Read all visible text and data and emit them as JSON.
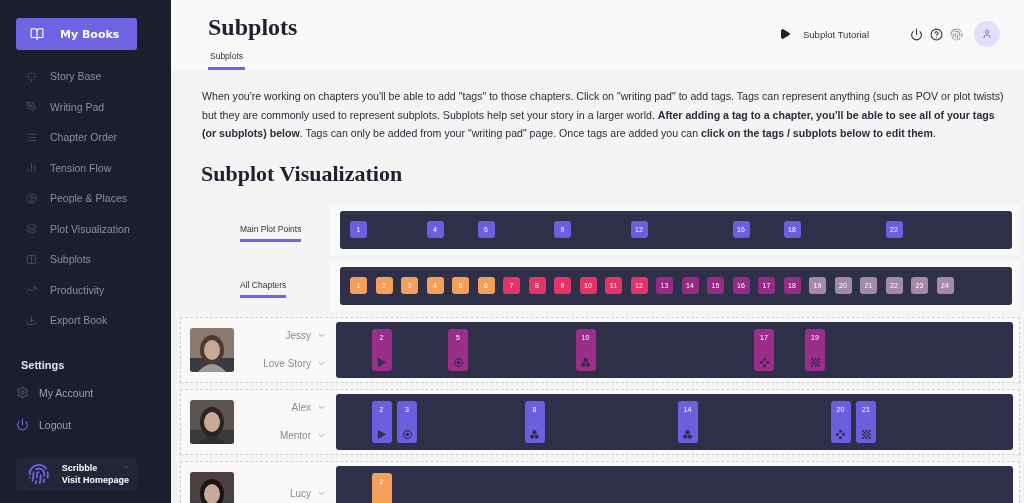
{
  "sidebar": {
    "primary_button": "My Books",
    "items": [
      {
        "label": "Story Base"
      },
      {
        "label": "Writing Pad"
      },
      {
        "label": "Chapter Order"
      },
      {
        "label": "Tension Flow"
      },
      {
        "label": "People & Places"
      },
      {
        "label": "Plot Visualization"
      },
      {
        "label": "Subplots"
      },
      {
        "label": "Productivity"
      },
      {
        "label": "Export Book"
      }
    ],
    "settings_heading": "Settings",
    "settings_items": [
      {
        "label": "My Account"
      },
      {
        "label": "Logout"
      }
    ],
    "footer": {
      "title": "Scribble",
      "link": "Visit Homepage"
    }
  },
  "header": {
    "title": "Subplots",
    "tabs": [
      {
        "label": "Subplots",
        "selected": true
      }
    ],
    "tutorial": "Subplot Tutorial"
  },
  "intro": "When you're working on chapters you'll be able to add \"tags\" to those chapters. Click on \"writing pad\" to add tags.  Tags can represent anything (such as POV or plot twists) but they are commonly used to represent subplots. Subplots help set your story in a larger world. **After adding a tag to a chapter, you'll be able to see all of your tags (or subplots) below**. Tags can only be added from your \"writing pad\" page. Once tags are added you can **click on the tags / subplots below to edit them**.",
  "visualization": {
    "heading": "Subplot Visualization",
    "main_plot_points": {
      "label": "Main Plot Points",
      "slots": [
        {
          "kind": "point",
          "label": "1"
        },
        {
          "kind": "gap"
        },
        {
          "kind": "gap"
        },
        {
          "kind": "point",
          "label": "4"
        },
        {
          "kind": "gap"
        },
        {
          "kind": "point",
          "label": "6"
        },
        {
          "kind": "gap"
        },
        {
          "kind": "gap"
        },
        {
          "kind": "point",
          "label": "9"
        },
        {
          "kind": "gap"
        },
        {
          "kind": "gap"
        },
        {
          "kind": "point",
          "label": "12"
        },
        {
          "kind": "gap"
        },
        {
          "kind": "gap"
        },
        {
          "kind": "gap"
        },
        {
          "kind": "point",
          "label": "16"
        },
        {
          "kind": "gap"
        },
        {
          "kind": "point",
          "label": "18"
        },
        {
          "kind": "gap"
        },
        {
          "kind": "gap"
        },
        {
          "kind": "gap"
        },
        {
          "kind": "point",
          "label": "22"
        }
      ]
    },
    "all_chapters": {
      "label": "All Chapters",
      "chapters": [
        {
          "label": "1",
          "color": "#f5a05a"
        },
        {
          "label": "2",
          "color": "#f5a05a"
        },
        {
          "label": "3",
          "color": "#f5a05a"
        },
        {
          "label": "4",
          "color": "#f5a05a"
        },
        {
          "label": "5",
          "color": "#f5a05a"
        },
        {
          "label": "6",
          "color": "#f5a05a"
        },
        {
          "label": "7",
          "color": "#e23566"
        },
        {
          "label": "8",
          "color": "#e23566"
        },
        {
          "label": "9",
          "color": "#e23566"
        },
        {
          "label": "10",
          "color": "#e23566"
        },
        {
          "label": "11",
          "color": "#e23566"
        },
        {
          "label": "12",
          "color": "#e23566"
        },
        {
          "label": "13",
          "color": "#932c82"
        },
        {
          "label": "14",
          "color": "#932c82"
        },
        {
          "label": "15",
          "color": "#932c82"
        },
        {
          "label": "16",
          "color": "#932c82"
        },
        {
          "label": "17",
          "color": "#932c82"
        },
        {
          "label": "18",
          "color": "#932c82"
        },
        {
          "label": "19",
          "color": "#a38aa8"
        },
        {
          "label": "20",
          "color": "#a38aa8"
        },
        {
          "label": "21",
          "color": "#a38aa8"
        },
        {
          "label": "22",
          "color": "#a38aa8"
        },
        {
          "label": "23",
          "color": "#a38aa8"
        },
        {
          "label": "24",
          "color": "#a38aa8"
        }
      ]
    },
    "subplots": [
      {
        "character": "Jessy",
        "subplot": "Love Story",
        "color": "#9b2e88",
        "tags": [
          {
            "kind": "gap"
          },
          {
            "label": "2",
            "kind": "play"
          },
          {
            "kind": "gap"
          },
          {
            "kind": "gap"
          },
          {
            "label": "5",
            "kind": "target"
          },
          {
            "kind": "gap"
          },
          {
            "kind": "gap"
          },
          {
            "kind": "gap"
          },
          {
            "kind": "gap"
          },
          {
            "label": "10",
            "kind": "trefoil"
          },
          {
            "kind": "gap"
          },
          {
            "kind": "gap"
          },
          {
            "kind": "gap"
          },
          {
            "kind": "gap"
          },
          {
            "kind": "gap"
          },
          {
            "kind": "gap"
          },
          {
            "label": "17",
            "kind": "diamond"
          },
          {
            "kind": "gap"
          },
          {
            "label": "19",
            "kind": "checker"
          }
        ]
      },
      {
        "character": "Alex",
        "subplot": "Mentor",
        "color": "#6b5fe0",
        "tags": [
          {
            "kind": "gap"
          },
          {
            "label": "2",
            "kind": "play"
          },
          {
            "label": "3",
            "kind": "target"
          },
          {
            "kind": "gap"
          },
          {
            "kind": "gap"
          },
          {
            "kind": "gap"
          },
          {
            "kind": "gap"
          },
          {
            "label": "8",
            "kind": "trefoil"
          },
          {
            "kind": "gap"
          },
          {
            "kind": "gap"
          },
          {
            "kind": "gap"
          },
          {
            "kind": "gap"
          },
          {
            "kind": "gap"
          },
          {
            "label": "14",
            "kind": "trefoil"
          },
          {
            "kind": "gap"
          },
          {
            "kind": "gap"
          },
          {
            "kind": "gap"
          },
          {
            "kind": "gap"
          },
          {
            "kind": "gap"
          },
          {
            "label": "20",
            "kind": "diamond"
          },
          {
            "label": "21",
            "kind": "checker"
          }
        ]
      },
      {
        "character": "Lucy",
        "color": "#f5a05a",
        "tags": [
          {
            "kind": "gap"
          },
          {
            "label": "2",
            "kind": "plain"
          }
        ]
      }
    ]
  }
}
